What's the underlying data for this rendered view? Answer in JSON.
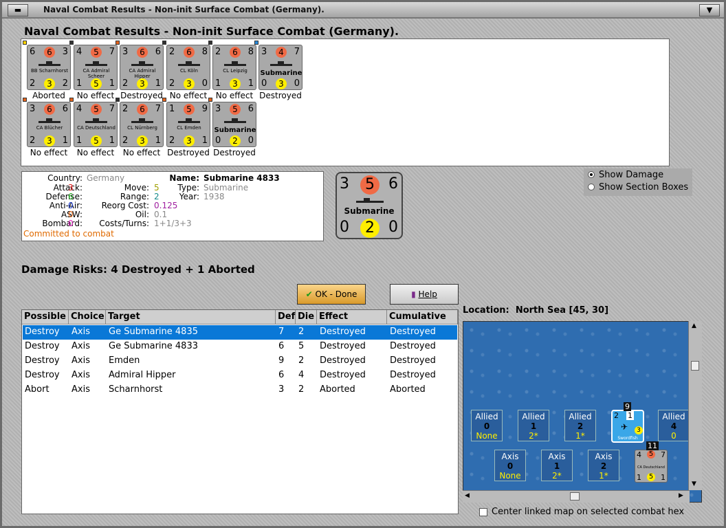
{
  "window": {
    "title": "Naval Combat Results - Non-init Surface Combat (Germany)."
  },
  "heading": "Naval Combat Results - Non-init Surface Combat (Germany).",
  "units": [
    {
      "a": "6",
      "d": "6",
      "m": "3",
      "b1": "2",
      "b2": "3",
      "b3": "2",
      "name": "BB Scharnhorst",
      "result": "Aborted"
    },
    {
      "a": "4",
      "d": "5",
      "m": "7",
      "b1": "1",
      "b2": "5",
      "b3": "1",
      "name": "CA Admiral Scheer",
      "result": "No effect"
    },
    {
      "a": "3",
      "d": "6",
      "m": "6",
      "b1": "2",
      "b2": "3",
      "b3": "1",
      "name": "CA Admiral Hipper",
      "result": "Destroyed"
    },
    {
      "a": "2",
      "d": "6",
      "m": "8",
      "b1": "2",
      "b2": "3",
      "b3": "0",
      "name": "CL Köln",
      "result": "No effect"
    },
    {
      "a": "2",
      "d": "6",
      "m": "8",
      "b1": "1",
      "b2": "3",
      "b3": "1",
      "name": "CL Leipzig",
      "result": "No effect"
    },
    {
      "a": "3",
      "d": "4",
      "m": "7",
      "b1": "0",
      "b2": "3",
      "b3": "0",
      "name": "Submarine",
      "result": "Destroyed"
    },
    {
      "a": "3",
      "d": "6",
      "m": "6",
      "b1": "2",
      "b2": "3",
      "b3": "1",
      "name": "CA Blücher",
      "result": "No effect"
    },
    {
      "a": "4",
      "d": "5",
      "m": "7",
      "b1": "1",
      "b2": "5",
      "b3": "1",
      "name": "CA Deutschland",
      "result": "No effect"
    },
    {
      "a": "2",
      "d": "6",
      "m": "7",
      "b1": "2",
      "b2": "3",
      "b3": "1",
      "name": "CL Nürnberg",
      "result": "No effect"
    },
    {
      "a": "1",
      "d": "5",
      "m": "9",
      "b1": "2",
      "b2": "3",
      "b3": "1",
      "name": "CL Emden",
      "result": "Destroyed"
    },
    {
      "a": "3",
      "d": "5",
      "m": "6",
      "b1": "0",
      "b2": "2",
      "b3": "0",
      "name": "Submarine",
      "result": "Destroyed"
    }
  ],
  "info": {
    "country_label": "Country:",
    "country": "Germany",
    "attack_label": "Attack:",
    "attack": "3",
    "defense_label": "Defense:",
    "defense": "6",
    "antiair_label": "Anti-Air:",
    "antiair": "0",
    "asw_label": "ASW:",
    "asw": "0",
    "bombard_label": "Bombard:",
    "bombard": "0",
    "move_label": "Move:",
    "move": "5",
    "range_label": "Range:",
    "range": "2",
    "reorg_label": "Reorg Cost:",
    "reorg": "0.125",
    "oil_label": "Oil:",
    "oil": "0.1",
    "costs_label": "Costs/Turns:",
    "costs": "1+1/3+3",
    "name_label": "Name:",
    "name": "Submarine 4833",
    "type_label": "Type:",
    "type": "Submarine",
    "year_label": "Year:",
    "year": "1938",
    "status": "Committed to combat"
  },
  "big_counter": {
    "a": "3",
    "d": "5",
    "m": "6",
    "b1": "0",
    "b2": "2",
    "b3": "0",
    "name": "Submarine"
  },
  "options": {
    "show_damage": "Show Damage",
    "show_sections": "Show Section Boxes"
  },
  "risks": "Damage Risks:  4 Destroyed + 1 Aborted",
  "buttons": {
    "ok": "OK - Done",
    "help": "Help"
  },
  "table": {
    "headers": [
      "Possible",
      "Choice",
      "Target",
      "Def",
      "Die",
      "Effect",
      "Cumulative"
    ],
    "rows": [
      [
        "Destroy",
        "Axis",
        "Ge Submarine 4835",
        "7",
        "2",
        "Destroyed",
        "Destroyed"
      ],
      [
        "Destroy",
        "Axis",
        "Ge Submarine 4833",
        "6",
        "5",
        "Destroyed",
        "Destroyed"
      ],
      [
        "Destroy",
        "Axis",
        "Emden",
        "9",
        "2",
        "Destroyed",
        "Destroyed"
      ],
      [
        "Destroy",
        "Axis",
        "Admiral Hipper",
        "6",
        "4",
        "Destroyed",
        "Destroyed"
      ],
      [
        "Abort",
        "Axis",
        "Scharnhorst",
        "3",
        "2",
        "Aborted",
        "Aborted"
      ]
    ]
  },
  "location": {
    "label": "Location:",
    "value": "North Sea [45, 30]"
  },
  "map": {
    "allied": [
      {
        "side": "Allied",
        "num": "0",
        "sub": "None"
      },
      {
        "side": "Allied",
        "num": "1",
        "sub": "2*"
      },
      {
        "side": "Allied",
        "num": "2",
        "sub": "1*"
      },
      {
        "side": "Allied",
        "num": "4",
        "sub": "0"
      }
    ],
    "axis": [
      {
        "side": "Axis",
        "num": "0",
        "sub": "None"
      },
      {
        "side": "Axis",
        "num": "1",
        "sub": "2*"
      },
      {
        "side": "Axis",
        "num": "2",
        "sub": "1*"
      }
    ],
    "swordfish": {
      "name": "Swordfish",
      "top": "9",
      "b": "2",
      "c": "1",
      "y": "3"
    },
    "deut": {
      "top": "11",
      "a": "4",
      "d": "5",
      "m": "7",
      "b1": "1",
      "b2": "5",
      "b3": "1",
      "name": "CA Deutschland"
    }
  },
  "center_label": "Center linked map on selected combat hex"
}
